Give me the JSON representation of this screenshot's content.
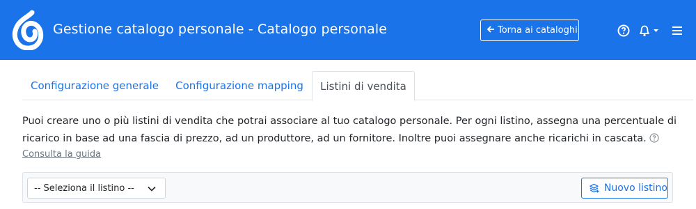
{
  "header": {
    "title": "Gestione catalogo personale - Catalogo personale",
    "back_button_label": "Torna ai cataloghi",
    "back_icon": "arrow-left-icon",
    "help_icon": "help-circle-icon",
    "notifications_icon": "bell-icon",
    "menu_icon": "hamburger-menu-icon",
    "background_color": "#1a73e8"
  },
  "tabs": [
    {
      "label": "Configurazione generale",
      "active": false
    },
    {
      "label": "Configurazione mapping",
      "active": false
    },
    {
      "label": "Listini di vendita",
      "active": true
    }
  ],
  "main": {
    "description": "Puoi creare uno o più listini di vendita che potrai associare al tuo catalogo personale. Per ogni listino, assegna una percentuale di ricarico in base ad una fascia di prezzo, ad un produttore, ad un fornitore. Inoltre puoi assegnare anche ricarichi in cascata.",
    "guide_link": "Consulta la guida",
    "price_list_select": {
      "selected": "-- Seleziona il listino --"
    },
    "new_button_label": "Nuovo listino",
    "new_button_icon": "layers-plus-icon"
  },
  "colors": {
    "accent": "#1a73e8",
    "link": "#1a73e8",
    "muted": "#6c757d"
  }
}
